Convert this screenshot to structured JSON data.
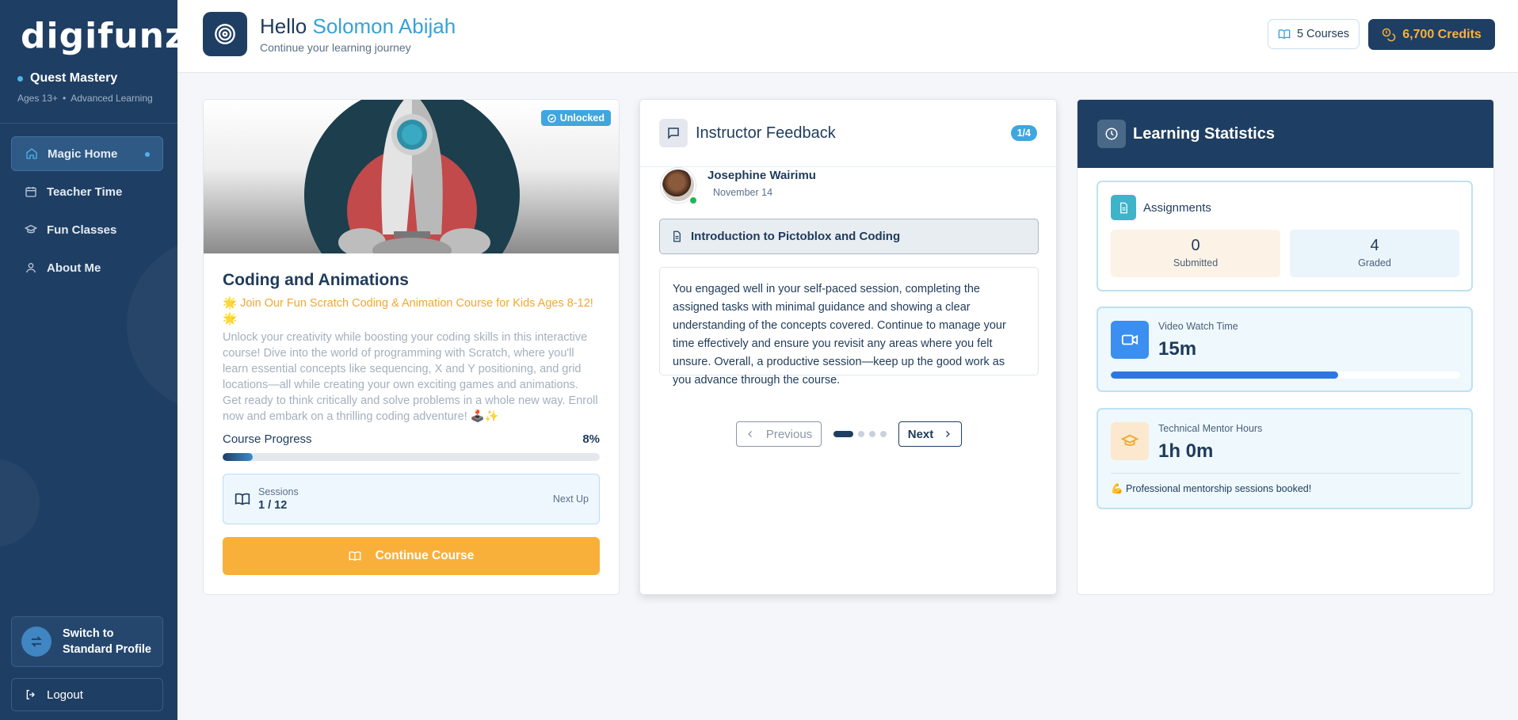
{
  "brand": {
    "logo_text": "digifunzi"
  },
  "profile": {
    "name": "Quest Mastery",
    "age": "Ages 13+",
    "level": "Advanced Learning"
  },
  "sidebar": {
    "items": [
      {
        "label": "Magic Home",
        "icon": "home-icon",
        "active": true
      },
      {
        "label": "Teacher Time",
        "icon": "calendar-icon",
        "active": false
      },
      {
        "label": "Fun Classes",
        "icon": "graduation-cap-icon",
        "active": false
      },
      {
        "label": "About Me",
        "icon": "user-icon",
        "active": false
      }
    ],
    "switch_label": "Switch to Standard Profile",
    "logout_label": "Logout"
  },
  "header": {
    "greeting": "Hello",
    "user_name": "Solomon Abijah",
    "subtitle": "Continue your learning journey",
    "courses": "5 Courses",
    "credits": "6,700 Credits"
  },
  "course": {
    "badge": "Unlocked",
    "title": "Coding and Animations",
    "tagline": "🌟 Join Our Fun Scratch Coding & Animation Course for Kids Ages 8-12! 🌟",
    "description": "Unlock your creativity while boosting your coding skills in this interactive course! Dive into the world of programming with Scratch, where you'll learn essential concepts like sequencing, X and Y positioning, and grid locations—all while creating your own exciting games and animations. Get ready to think critically and solve problems in a whole new way. Enroll now and embark on a thrilling coding adventure! 🕹️✨",
    "progress_label": "Course Progress",
    "progress_text": "8%",
    "progress_value": 0.08,
    "sessions_label": "Sessions",
    "sessions_value": "1 / 12",
    "next_up": "Next Up",
    "continue_label": "Continue Course"
  },
  "feedback": {
    "title": "Instructor Feedback",
    "counter": "1/4",
    "instructor": "Josephine Wairimu",
    "date": "November 14",
    "topic": "Introduction to Pictoblox and Coding",
    "text": "You engaged well in your self-paced session, completing the assigned tasks with minimal guidance and showing a clear understanding of the concepts covered. Continue to manage your time effectively and ensure you revisit any areas where you felt unsure. Overall, a productive session—keep up the good work as you advance through the course.",
    "prev_label": "Previous",
    "next_label": "Next",
    "page_count": 4,
    "current_page": 1
  },
  "stats": {
    "title": "Learning Statistics",
    "assignments_label": "Assignments",
    "submitted_value": "0",
    "submitted_label": "Submitted",
    "graded_value": "4",
    "graded_label": "Graded",
    "video_label": "Video Watch Time",
    "video_value": "15m",
    "video_progress": 0.65,
    "mentor_label": "Technical Mentor Hours",
    "mentor_value": "1h 0m",
    "mentor_note": "💪 Professional mentorship sessions booked!"
  },
  "colors": {
    "navy": "#1f3e63",
    "accent_blue": "#36a2d8",
    "orange": "#f9b03a",
    "credits_gold": "#f8b23c"
  }
}
